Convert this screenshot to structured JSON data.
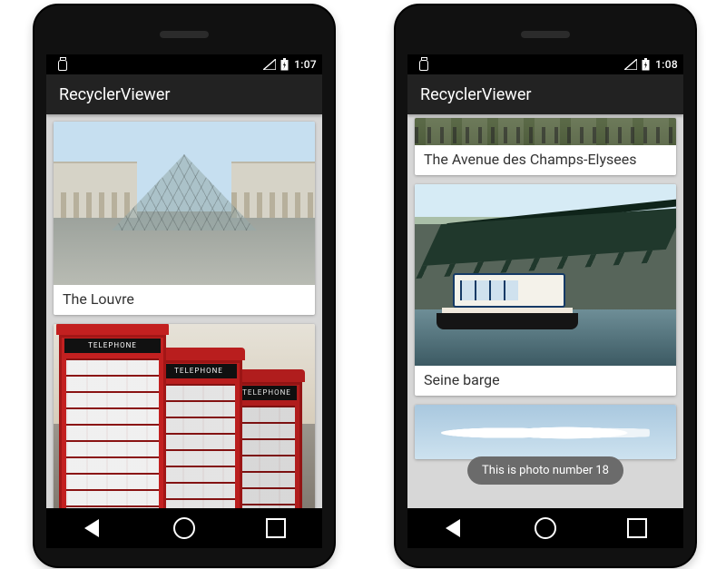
{
  "phones": {
    "left": {
      "status_bar": {
        "time": "1:07"
      },
      "app_bar": {
        "title": "RecyclerViewer"
      },
      "cards": [
        {
          "caption": "The Louvre"
        },
        {
          "caption": ""
        }
      ]
    },
    "right": {
      "status_bar": {
        "time": "1:08"
      },
      "app_bar": {
        "title": "RecyclerViewer"
      },
      "cards": [
        {
          "caption": "The Avenue des Champs-Elysees"
        },
        {
          "caption": "Seine barge"
        },
        {
          "caption": ""
        }
      ],
      "toast": "This is photo number 18"
    }
  },
  "booth_sign": "TELEPHONE"
}
